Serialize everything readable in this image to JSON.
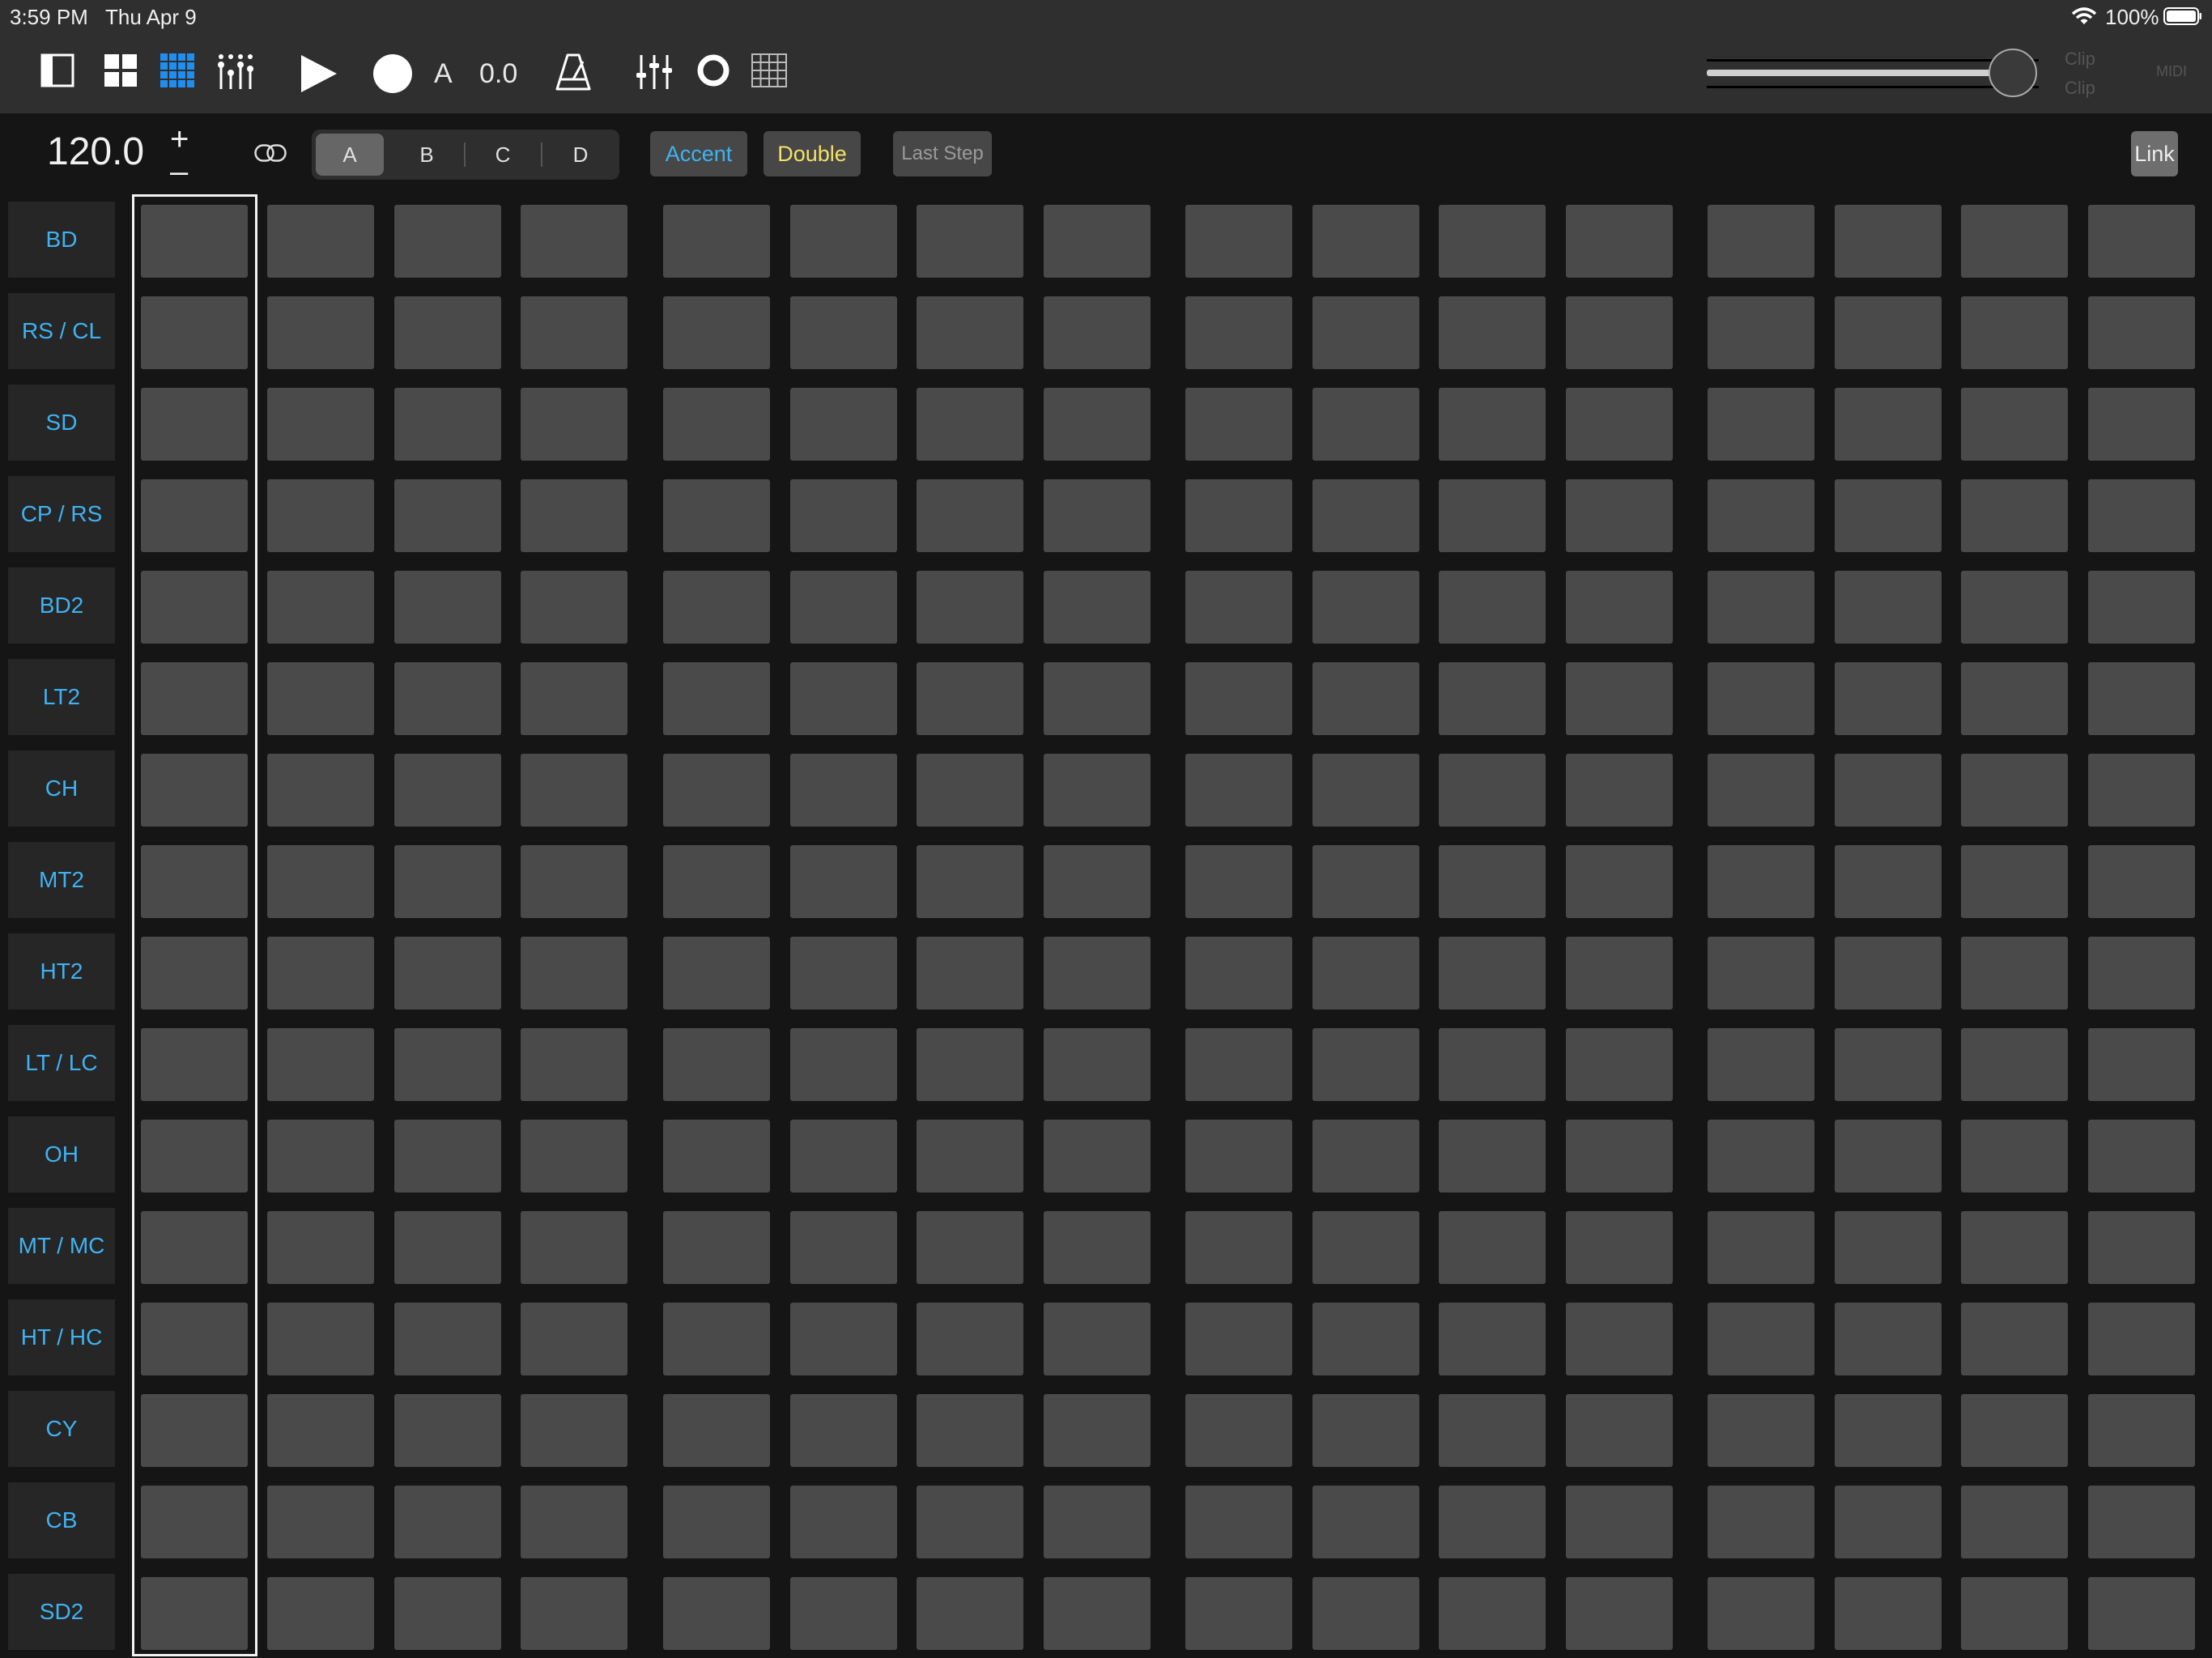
{
  "status_bar": {
    "time": "3:59 PM",
    "date": "Thu Apr 9",
    "battery": "100%"
  },
  "toolbar": {
    "track_label": "A",
    "value": "0.0",
    "clip_top": "Clip",
    "clip_bottom": "Clip",
    "midi": "MIDI",
    "icons": [
      "sidebar-icon",
      "grid-2x2-icon",
      "grid-4x4-icon",
      "mixer-dots-icon",
      "play-icon",
      "record-icon",
      "metronome-icon",
      "faders-icon",
      "loop-circle-icon",
      "grid-table-icon"
    ]
  },
  "transport": {
    "tempo": "120.0",
    "plus": "+",
    "minus": "–",
    "patterns": [
      "A",
      "B",
      "C",
      "D"
    ],
    "active_pattern": "A",
    "accent": "Accent",
    "double": "Double",
    "last_step": "Last Step",
    "link": "Link"
  },
  "colors": {
    "accent_blue": "#3fb2f2",
    "double_yellow": "#f3e268",
    "step_off": "#4a4a4a"
  },
  "grid": {
    "lanes": [
      "BD",
      "RS / CL",
      "SD",
      "CP / RS",
      "BD2",
      "LT2",
      "CH",
      "MT2",
      "HT2",
      "LT / LC",
      "OH",
      "MT / MC",
      "HT / HC",
      "CY",
      "CB",
      "SD2"
    ],
    "steps": 16,
    "current_step": 1
  }
}
